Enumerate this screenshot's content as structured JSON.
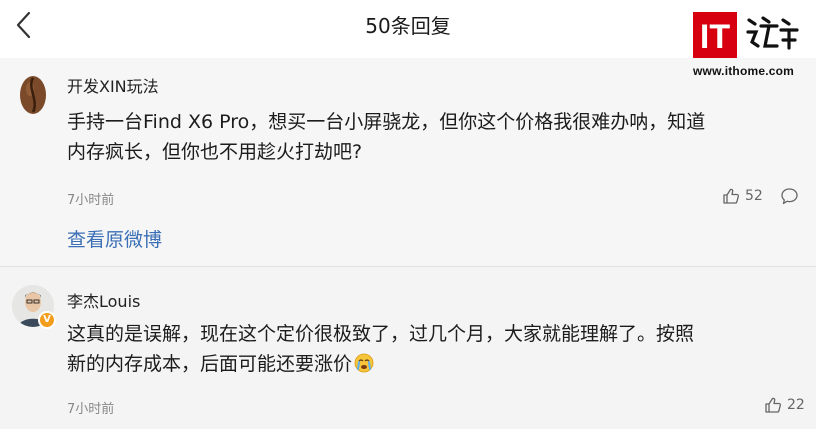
{
  "header": {
    "title": "50条回复",
    "logo_text": "IT之家",
    "site_url": "www.ithome.com",
    "brand_color": "#d7000f"
  },
  "comments": [
    {
      "user": "开发XIN玩法",
      "text_line1": "手持一台Find X6 Pro，想买一台小屏骁龙，但你这个价格我很难办呐，知道",
      "text_line2": "内存疯长，但你也不用趁火打劫吧?",
      "time": "7小时前",
      "likes": "52",
      "view_original": "查看原微博"
    },
    {
      "user": "李杰Louis",
      "text_line1": "这真的是误解，现在这个定价很极致了，过几个月，大家就能理解了。按照",
      "text_line2": "新的内存成本，后面可能还要涨价",
      "emoji": "crying-emoji",
      "time": "7小时前",
      "likes": "22",
      "verified_badge": "V"
    }
  ]
}
